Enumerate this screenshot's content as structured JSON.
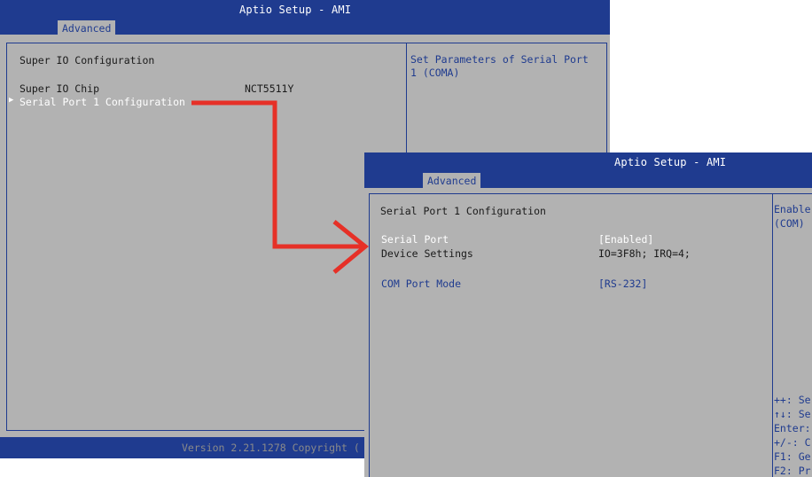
{
  "screen1": {
    "title": "Aptio Setup - AMI",
    "tab": "Advanced",
    "heading": "Super IO Configuration",
    "chip_label": "Super IO Chip",
    "chip_value": "NCT5511Y",
    "serial_item_marker": "▶",
    "serial_item": "Serial Port 1 Configuration",
    "help_text": "Set Parameters of Serial Port 1 (COMA)",
    "footer": "Version 2.21.1278 Copyright ("
  },
  "screen2": {
    "title": "Aptio Setup - AMI",
    "tab": "Advanced",
    "heading": "Serial Port 1 Configuration",
    "rows": [
      {
        "label": "Serial Port",
        "value": "[Enabled]"
      },
      {
        "label": "Device Settings",
        "value": "IO=3F8h; IRQ=4;"
      },
      {
        "label": "COM Port Mode",
        "value": "[RS-232]"
      }
    ],
    "help_lines": [
      "Enable",
      "(COM)"
    ],
    "key_help": [
      "++: Se",
      "↑↓: Se",
      "Enter:",
      "+/-: C",
      "F1: Ge",
      "F2: Pr"
    ]
  },
  "colors": {
    "bios_blue": "#1f3b8f",
    "bios_gray": "#b2b2b2",
    "arrow_red": "#e63027"
  }
}
